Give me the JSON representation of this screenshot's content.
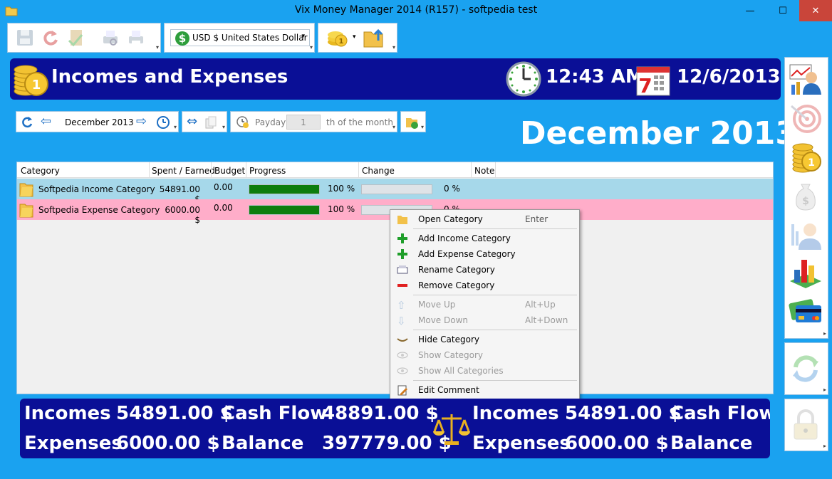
{
  "window": {
    "title": "Vix Money Manager 2014 (R157) - softpedia test",
    "minimize": "—",
    "maximize": "☐",
    "close": "✕"
  },
  "toolbar": {
    "currency": "USD $ United States Dollar"
  },
  "header": {
    "title": "Incomes and Expenses",
    "time": "12:43 AM",
    "date": "12/6/2013",
    "calendar_day": "7"
  },
  "nav": {
    "month": "December 2013",
    "payday_label": "Payday",
    "payday_value": "1",
    "payday_suffix": "th of the month"
  },
  "month_heading": "December 2013",
  "grid": {
    "columns": [
      "Category",
      "Spent / Earned",
      "Budget",
      "Progress",
      "Change",
      "Note"
    ],
    "rows": [
      {
        "category": "Softpedia Income Category",
        "amount": "54891.00 $",
        "budget": "0.00",
        "progress_pct": "100 %",
        "progress": 1.0,
        "change_pct": "0 %",
        "change": 0,
        "color": "#a6d8ea"
      },
      {
        "category": "Softpedia Expense Category",
        "amount": "6000.00 $",
        "budget": "0.00",
        "progress_pct": "100 %",
        "progress": 1.0,
        "change_pct": "0 %",
        "change": 0,
        "color": "#ffadc9"
      }
    ]
  },
  "context_menu": {
    "open": "Open Category",
    "open_key": "Enter",
    "add_income": "Add Income Category",
    "add_expense": "Add Expense Category",
    "rename": "Rename Category",
    "remove": "Remove Category",
    "move_up": "Move Up",
    "move_up_key": "Alt+Up",
    "move_down": "Move Down",
    "move_down_key": "Alt+Down",
    "hide": "Hide Category",
    "show": "Show Category",
    "show_all": "Show All Categories",
    "edit_comment": "Edit Comment"
  },
  "summary": {
    "incomes_label": "Incomes",
    "incomes_value": "54891.00 $",
    "cashflow_label": "Cash Flow",
    "cashflow_value": "48891.00 $",
    "expenses_label": "Expenses",
    "expenses_value": "6000.00 $",
    "balance_label": "Balance",
    "balance_value": "397779.00 $",
    "incomes_label_2": "Incomes",
    "incomes_value_2": "54891.00 $",
    "cashflow_label_2": "Cash Flow",
    "expenses_label_2": "Expenses",
    "expenses_value_2": "6000.00 $",
    "balance_label_2": "Balance"
  },
  "colors": {
    "accent": "#1aa2f0",
    "banner": "#0a0f96",
    "progress": "#0d7d0d",
    "income_row": "#a6d8ea",
    "expense_row": "#ffadc9"
  }
}
